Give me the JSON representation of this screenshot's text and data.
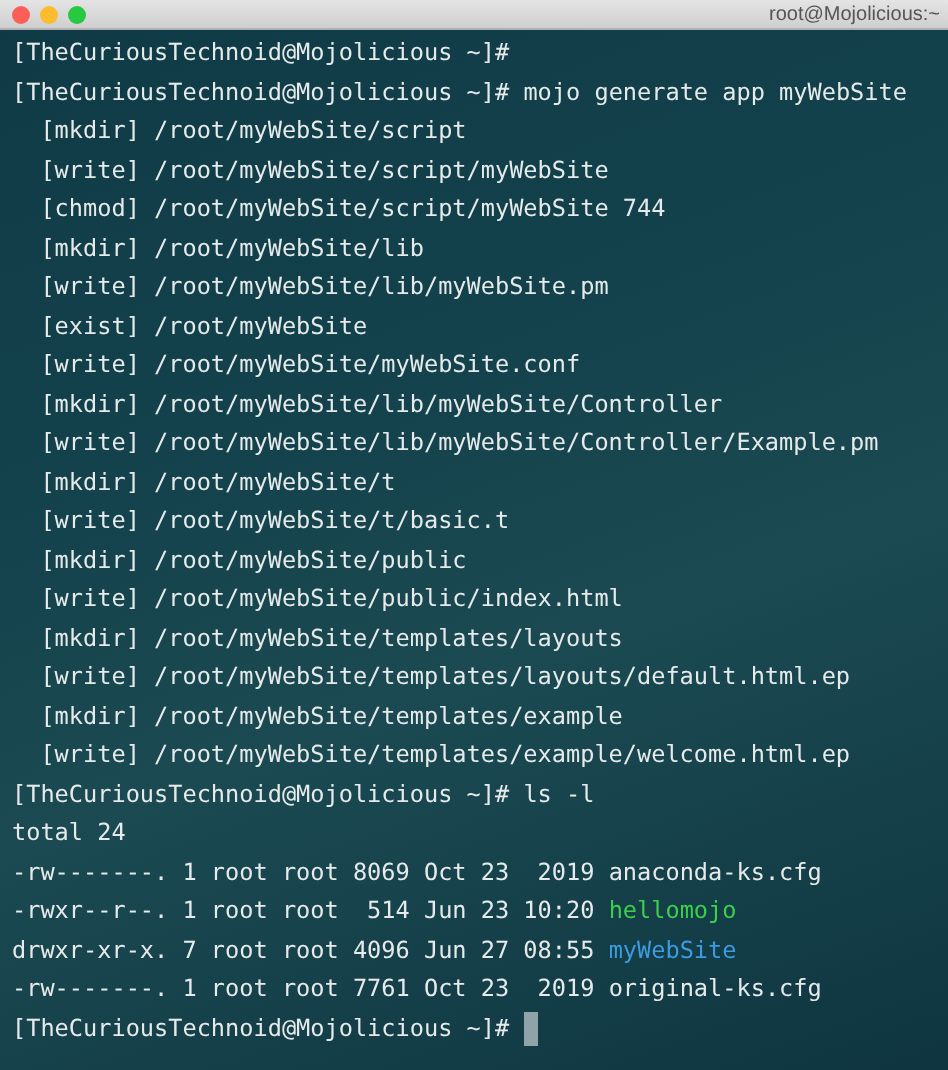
{
  "window": {
    "title": "root@Mojolicious:~"
  },
  "lines": [
    {
      "kind": "prompt",
      "prompt": "[TheCuriousTechnoid@Mojolicious ~]#",
      "cursor": false
    },
    {
      "kind": "prompt",
      "prompt": "[TheCuriousTechnoid@Mojolicious ~]#",
      "command": "mojo generate app myWebSite",
      "cursor": false
    },
    {
      "kind": "output",
      "text": "  [mkdir] /root/myWebSite/script"
    },
    {
      "kind": "output",
      "text": "  [write] /root/myWebSite/script/myWebSite"
    },
    {
      "kind": "output",
      "text": "  [chmod] /root/myWebSite/script/myWebSite 744"
    },
    {
      "kind": "output",
      "text": "  [mkdir] /root/myWebSite/lib"
    },
    {
      "kind": "output",
      "text": "  [write] /root/myWebSite/lib/myWebSite.pm"
    },
    {
      "kind": "output",
      "text": "  [exist] /root/myWebSite"
    },
    {
      "kind": "output",
      "text": "  [write] /root/myWebSite/myWebSite.conf"
    },
    {
      "kind": "output",
      "text": "  [mkdir] /root/myWebSite/lib/myWebSite/Controller"
    },
    {
      "kind": "output",
      "text": "  [write] /root/myWebSite/lib/myWebSite/Controller/Example.pm"
    },
    {
      "kind": "output",
      "text": "  [mkdir] /root/myWebSite/t"
    },
    {
      "kind": "output",
      "text": "  [write] /root/myWebSite/t/basic.t"
    },
    {
      "kind": "output",
      "text": "  [mkdir] /root/myWebSite/public"
    },
    {
      "kind": "output",
      "text": "  [write] /root/myWebSite/public/index.html"
    },
    {
      "kind": "output",
      "text": "  [mkdir] /root/myWebSite/templates/layouts"
    },
    {
      "kind": "output",
      "text": "  [write] /root/myWebSite/templates/layouts/default.html.ep"
    },
    {
      "kind": "output",
      "text": "  [mkdir] /root/myWebSite/templates/example"
    },
    {
      "kind": "output",
      "text": "  [write] /root/myWebSite/templates/example/welcome.html.ep"
    },
    {
      "kind": "prompt",
      "prompt": "[TheCuriousTechnoid@Mojolicious ~]#",
      "command": "ls -l",
      "cursor": false
    },
    {
      "kind": "output",
      "text": "total 24"
    },
    {
      "kind": "listing",
      "text": "-rw-------. 1 root root 8069 Oct 23  2019",
      "name": "anaconda-ks.cfg",
      "color": "#e6eaea"
    },
    {
      "kind": "listing",
      "text": "-rwxr--r--. 1 root root  514 Jun 23 10:20",
      "name": "hellomojo",
      "color": "#3ccf4a"
    },
    {
      "kind": "listing",
      "text": "drwxr-xr-x. 7 root root 4096 Jun 27 08:55",
      "name": "myWebSite",
      "color": "#3d9be0"
    },
    {
      "kind": "listing",
      "text": "-rw-------. 1 root root 7761 Oct 23  2019",
      "name": "original-ks.cfg",
      "color": "#e6eaea"
    },
    {
      "kind": "prompt",
      "prompt": "[TheCuriousTechnoid@Mojolicious ~]#",
      "cursor": true
    }
  ]
}
